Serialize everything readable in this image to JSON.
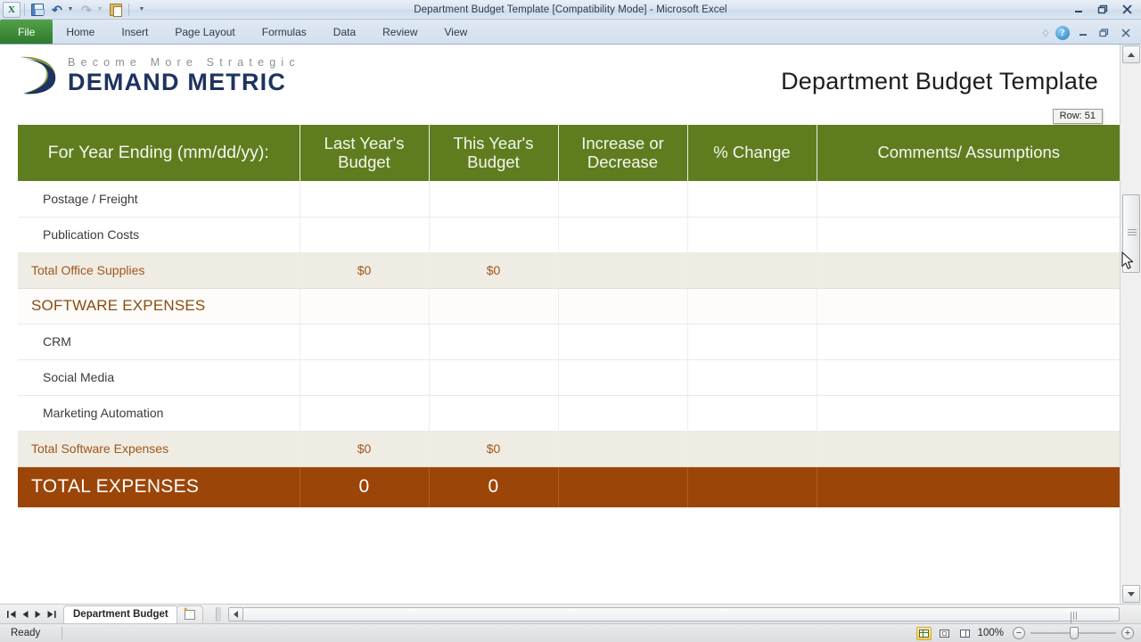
{
  "window": {
    "title": "Department Budget Template  [Compatibility Mode]  -  Microsoft Excel",
    "minimize_label": "Minimize",
    "restore_label": "Restore Down",
    "close_label": "Close"
  },
  "quick_access": {
    "app_logo": "excel-logo",
    "items": [
      {
        "name": "save-icon",
        "label": "Save"
      },
      {
        "name": "undo-icon",
        "label": "Undo"
      },
      {
        "name": "redo-icon",
        "label": "Redo"
      },
      {
        "name": "paste-icon",
        "label": "Paste"
      },
      {
        "name": "customize-qat-icon",
        "label": "Customize Quick Access Toolbar"
      }
    ]
  },
  "ribbon": {
    "tabs": [
      {
        "label": "File",
        "active": true
      },
      {
        "label": "Home",
        "active": false
      },
      {
        "label": "Insert",
        "active": false
      },
      {
        "label": "Page Layout",
        "active": false
      },
      {
        "label": "Formulas",
        "active": false
      },
      {
        "label": "Data",
        "active": false
      },
      {
        "label": "Review",
        "active": false
      },
      {
        "label": "View",
        "active": false
      }
    ],
    "minimize_ribbon_icon": "chevron-up-icon",
    "help_label": "?"
  },
  "document": {
    "brand_tagline": "Become More Strategic",
    "brand_name": "DEMAND METRIC",
    "title": "Department Budget Template",
    "row_tooltip": "Row: 51"
  },
  "table": {
    "headers": [
      "For Year Ending (mm/dd/yy):",
      "Last Year's Budget",
      "This Year's Budget",
      "Increase or Decrease",
      "% Change",
      "Comments/ Assumptions"
    ],
    "rows": [
      {
        "type": "item",
        "cells": [
          "Postage / Freight",
          "",
          "",
          "",
          "",
          ""
        ]
      },
      {
        "type": "item",
        "cells": [
          "Publication Costs",
          "",
          "",
          "",
          "",
          ""
        ]
      },
      {
        "type": "subtotal",
        "cells": [
          "Total Office Supplies",
          "$0",
          "$0",
          "",
          "",
          ""
        ]
      },
      {
        "type": "section",
        "cells": [
          "SOFTWARE EXPENSES",
          "",
          "",
          "",
          "",
          ""
        ]
      },
      {
        "type": "item",
        "cells": [
          "CRM",
          "",
          "",
          "",
          "",
          ""
        ]
      },
      {
        "type": "item",
        "cells": [
          "Social Media",
          "",
          "",
          "",
          "",
          ""
        ]
      },
      {
        "type": "item",
        "cells": [
          "Marketing Automation",
          "",
          "",
          "",
          "",
          ""
        ]
      },
      {
        "type": "subtotal",
        "cells": [
          "Total Software Expenses",
          "$0",
          "$0",
          "",
          "",
          ""
        ]
      },
      {
        "type": "grand",
        "cells": [
          "TOTAL EXPENSES",
          "0",
          "0",
          "",
          "",
          ""
        ]
      }
    ]
  },
  "sheet_tabs": {
    "first_label": "First Sheet",
    "prev_label": "Previous Sheet",
    "next_label": "Next Sheet",
    "last_label": "Last Sheet",
    "tabs": [
      {
        "label": "Department Budget",
        "active": true
      }
    ],
    "insert_sheet_label": "Insert Worksheet"
  },
  "status": {
    "mode": "Ready",
    "views": [
      {
        "name": "normal-view-button",
        "label": "Normal",
        "active": true
      },
      {
        "name": "page-layout-view-button",
        "label": "Page Layout",
        "active": false
      },
      {
        "name": "page-break-view-button",
        "label": "Page Break Preview",
        "active": false
      }
    ],
    "zoom_level": "100%",
    "zoom_out_label": "−",
    "zoom_in_label": "+"
  },
  "colors": {
    "header_green": "#5f7d1f",
    "grand_total_brown": "#9c4508",
    "subtotal_beige": "#efece3",
    "subtotal_text": "#a0561a",
    "section_text": "#8a4b10",
    "brand_navy": "#1f3360",
    "brand_olive": "#7a9a3c"
  }
}
